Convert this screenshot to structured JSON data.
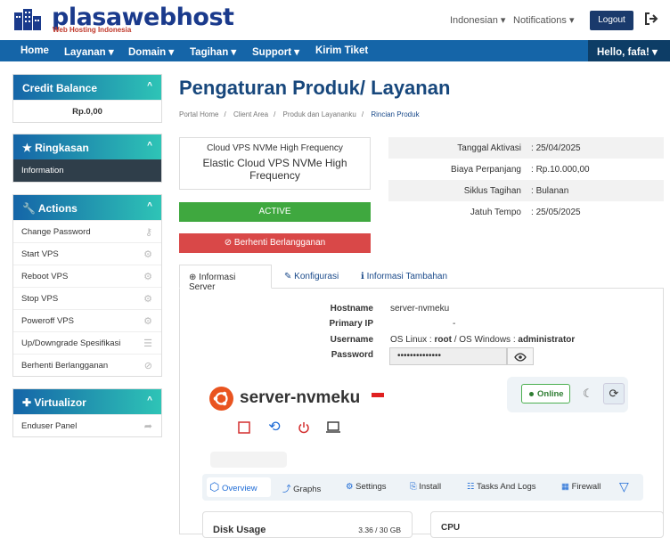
{
  "brand": {
    "name": "plasawebhost",
    "tagline": "Web Hosting Indonesia"
  },
  "header": {
    "language": "Indonesian",
    "notifications": "Notifications",
    "logout": "Logout"
  },
  "nav": {
    "items": [
      "Home",
      "Layanan",
      "Domain",
      "Tagihan",
      "Support",
      "Kirim Tiket"
    ],
    "user": "Hello, fafa!"
  },
  "sidebar": {
    "credit": {
      "title": "Credit Balance",
      "value": "Rp.0,00"
    },
    "summary": {
      "title": "Ringkasan",
      "items": [
        "Information"
      ]
    },
    "actions": {
      "title": "Actions",
      "items": [
        "Change Password",
        "Start VPS",
        "Reboot VPS",
        "Stop VPS",
        "Poweroff VPS",
        "Up/Downgrade Spesifikasi",
        "Berhenti Berlangganan"
      ]
    },
    "virtualizor": {
      "title": "Virtualizor",
      "items": [
        "Enduser Panel"
      ]
    }
  },
  "page": {
    "title": "Pengaturan Produk/ Layanan",
    "breadcrumb": [
      "Portal Home",
      "Client Area",
      "Produk dan Layananku",
      "Rincian Produk"
    ]
  },
  "product": {
    "tier": "Cloud VPS NVMe High Frequency",
    "name": "Elastic Cloud VPS NVMe High Frequency",
    "status": "ACTIVE",
    "cancel_label": "Berhenti Berlangganan"
  },
  "billing": [
    {
      "label": "Tanggal Aktivasi",
      "value": "25/04/2025"
    },
    {
      "label": "Biaya Perpanjang",
      "value": "Rp.10.000,00"
    },
    {
      "label": "Siklus Tagihan",
      "value": "Bulanan"
    },
    {
      "label": "Jatuh Tempo",
      "value": "25/05/2025"
    }
  ],
  "tabs": [
    "Informasi Server",
    "Konfigurasi",
    "Informasi Tambahan"
  ],
  "server": {
    "hostname_label": "Hostname",
    "hostname": "server-nvmeku",
    "ip_label": "Primary IP",
    "ip": "-",
    "username_label": "Username",
    "username_prefix": "OS Linux : ",
    "username_linux": "root",
    "username_mid": " / OS Windows : ",
    "username_windows": "administrator",
    "password_label": "Password",
    "password_mask": "••••••••••••••"
  },
  "vm": {
    "name": "server-nvmeku",
    "status": "Online",
    "tabs": [
      "Overview",
      "Graphs",
      "Settings",
      "Install",
      "Tasks And Logs",
      "Firewall"
    ],
    "disk_title": "Disk Usage",
    "disk_value": "3.36 / 30 GB",
    "cpu_title": "CPU"
  },
  "colors": {
    "primary": "#1565a8",
    "dark": "#0d3d66",
    "teal": "#2ec4b6",
    "active": "#3fa83f",
    "danger": "#d94848"
  }
}
